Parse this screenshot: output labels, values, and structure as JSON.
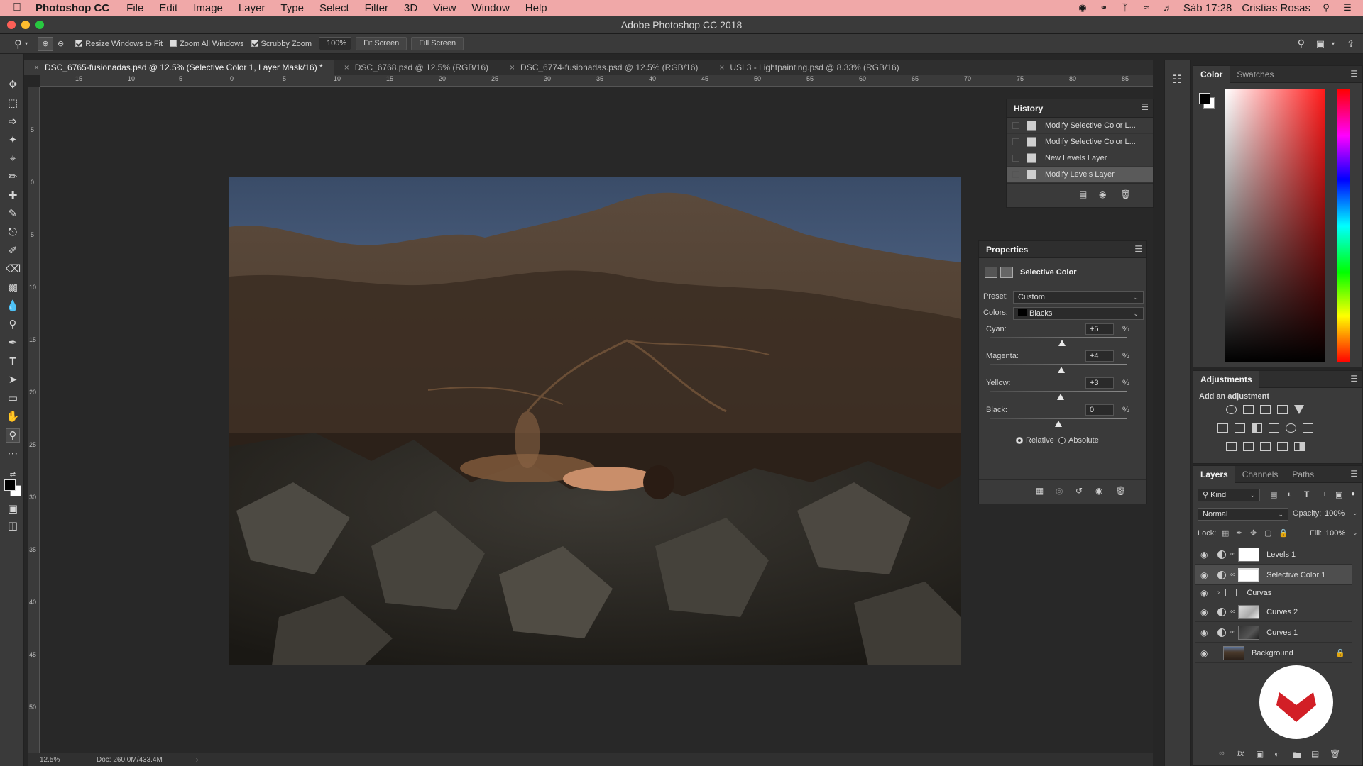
{
  "menubar": {
    "app_name": "Photoshop CC",
    "items": [
      "File",
      "Edit",
      "Image",
      "Layer",
      "Type",
      "Select",
      "Filter",
      "3D",
      "View",
      "Window",
      "Help"
    ],
    "clock": "Sáb 17:28",
    "user": "Cristias Rosas"
  },
  "window": {
    "title": "Adobe Photoshop CC 2018"
  },
  "options": {
    "resize_windows": "Resize Windows to Fit",
    "zoom_all": "Zoom All Windows",
    "scrubby": "Scrubby Zoom",
    "zoom_value": "100%",
    "fit_screen": "Fit Screen",
    "fill_screen": "Fill Screen"
  },
  "doc_tabs": [
    "DSC_6765-fusionadas.psd @ 12.5% (Selective Color 1, Layer Mask/16) *",
    "DSC_6768.psd @ 12.5% (RGB/16)",
    "DSC_6774-fusionadas.psd @ 12.5% (RGB/16)",
    "USL3 - Lightpainting.psd @ 8.33% (RGB/16)"
  ],
  "ruler": {
    "h": [
      "15",
      "10",
      "5",
      "0",
      "5",
      "10",
      "15",
      "20",
      "25",
      "30",
      "35",
      "40",
      "45",
      "50",
      "55",
      "60",
      "65",
      "70",
      "75",
      "80",
      "85"
    ],
    "v": [
      "5",
      "0",
      "5",
      "10",
      "15",
      "20",
      "25",
      "30",
      "35",
      "40",
      "45",
      "50"
    ]
  },
  "status": {
    "zoom": "12.5%",
    "doc": "Doc: 260.0M/433.4M"
  },
  "history": {
    "title": "History",
    "items": [
      "Modify Selective Color L...",
      "Modify Selective Color L...",
      "New Levels Layer",
      "Modify Levels Layer"
    ]
  },
  "properties": {
    "title": "Properties",
    "adjustment": "Selective Color",
    "preset_label": "Preset:",
    "preset_value": "Custom",
    "colors_label": "Colors:",
    "colors_value": "Blacks",
    "sliders": [
      {
        "label": "Cyan:",
        "value": "+5",
        "level": 0.525
      },
      {
        "label": "Magenta:",
        "value": "+4",
        "level": 0.52
      },
      {
        "label": "Yellow:",
        "value": "+3",
        "level": 0.515
      },
      {
        "label": "Black:",
        "value": "0",
        "level": 0.5
      }
    ],
    "pct": "%",
    "relative": "Relative",
    "absolute": "Absolute"
  },
  "color_panel": {
    "tabs": [
      "Color",
      "Swatches"
    ]
  },
  "adjustments": {
    "title": "Adjustments",
    "subtitle": "Add an adjustment"
  },
  "layers_panel": {
    "tabs": [
      "Layers",
      "Channels",
      "Paths"
    ],
    "kind": "Kind",
    "blend_mode": "Normal",
    "opacity_label": "Opacity:",
    "opacity_value": "100%",
    "lock_label": "Lock:",
    "fill_label": "Fill:",
    "fill_value": "100%",
    "layers": [
      "Levels 1",
      "Selective Color 1",
      "Curvas",
      "Curves 2",
      "Curves 1",
      "Background"
    ]
  }
}
